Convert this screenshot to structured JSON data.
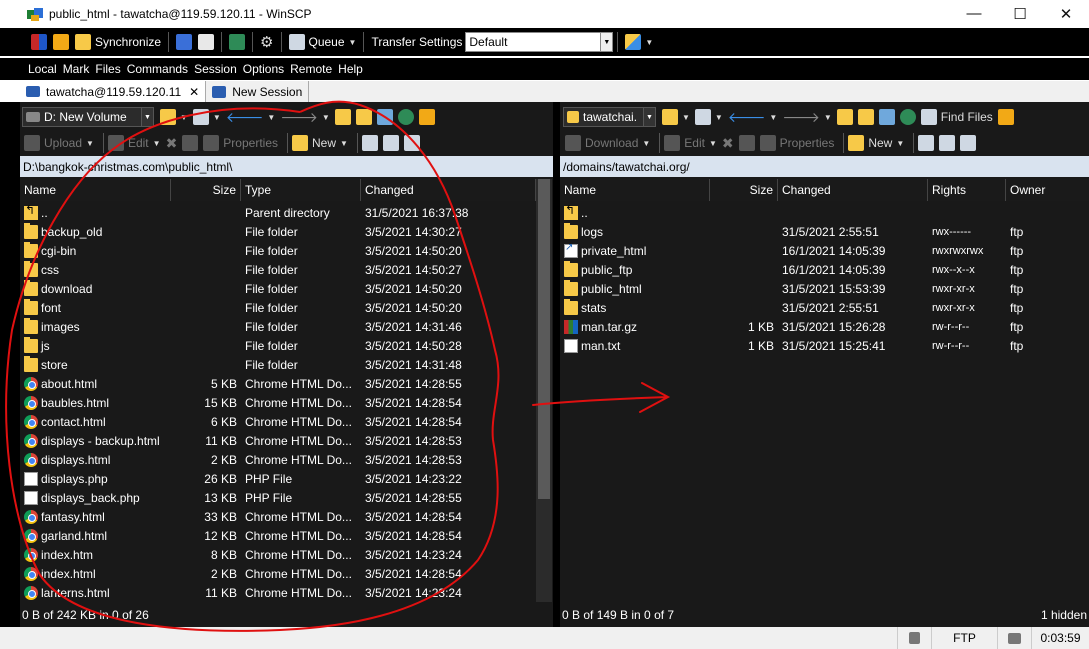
{
  "window": {
    "title": "public_html - tawatcha@119.59.120.11 - WinSCP"
  },
  "toolbar": {
    "synchronize": "Synchronize",
    "queue": "Queue",
    "transfer_settings_label": "Transfer Settings",
    "transfer_settings_value": "Default"
  },
  "menu": [
    "Local",
    "Mark",
    "Files",
    "Commands",
    "Session",
    "Options",
    "Remote",
    "Help"
  ],
  "tabs": [
    {
      "label": "tawatcha@119.59.120.11"
    },
    {
      "label": "New Session"
    }
  ],
  "left": {
    "drive": "D: New Volume",
    "actions": {
      "upload": "Upload",
      "edit": "Edit",
      "properties": "Properties",
      "new": "New"
    },
    "path": "D:\\bangkok-christmas.com\\public_html\\",
    "columns": [
      "Name",
      "Size",
      "Type",
      "Changed"
    ],
    "files": [
      {
        "name": "..",
        "size": "",
        "type": "Parent directory",
        "changed": "31/5/2021  16:37:38",
        "icon": "parent"
      },
      {
        "name": "backup_old",
        "size": "",
        "type": "File folder",
        "changed": "3/5/2021  14:30:27",
        "icon": "folder"
      },
      {
        "name": "cgi-bin",
        "size": "",
        "type": "File folder",
        "changed": "3/5/2021  14:50:20",
        "icon": "folder"
      },
      {
        "name": "css",
        "size": "",
        "type": "File folder",
        "changed": "3/5/2021  14:50:27",
        "icon": "folder"
      },
      {
        "name": "download",
        "size": "",
        "type": "File folder",
        "changed": "3/5/2021  14:50:20",
        "icon": "folder"
      },
      {
        "name": "font",
        "size": "",
        "type": "File folder",
        "changed": "3/5/2021  14:50:20",
        "icon": "folder"
      },
      {
        "name": "images",
        "size": "",
        "type": "File folder",
        "changed": "3/5/2021  14:31:46",
        "icon": "folder"
      },
      {
        "name": "js",
        "size": "",
        "type": "File folder",
        "changed": "3/5/2021  14:50:28",
        "icon": "folder"
      },
      {
        "name": "store",
        "size": "",
        "type": "File folder",
        "changed": "3/5/2021  14:31:48",
        "icon": "folder"
      },
      {
        "name": "about.html",
        "size": "5 KB",
        "type": "Chrome HTML Do...",
        "changed": "3/5/2021  14:28:55",
        "icon": "chrome"
      },
      {
        "name": "baubles.html",
        "size": "15 KB",
        "type": "Chrome HTML Do...",
        "changed": "3/5/2021  14:28:54",
        "icon": "chrome"
      },
      {
        "name": "contact.html",
        "size": "6 KB",
        "type": "Chrome HTML Do...",
        "changed": "3/5/2021  14:28:54",
        "icon": "chrome"
      },
      {
        "name": "displays - backup.html",
        "size": "11 KB",
        "type": "Chrome HTML Do...",
        "changed": "3/5/2021  14:28:53",
        "icon": "chrome"
      },
      {
        "name": "displays.html",
        "size": "2 KB",
        "type": "Chrome HTML Do...",
        "changed": "3/5/2021  14:28:53",
        "icon": "chrome"
      },
      {
        "name": "displays.php",
        "size": "26 KB",
        "type": "PHP File",
        "changed": "3/5/2021  14:23:22",
        "icon": "doc"
      },
      {
        "name": "displays_back.php",
        "size": "13 KB",
        "type": "PHP File",
        "changed": "3/5/2021  14:28:55",
        "icon": "doc"
      },
      {
        "name": "fantasy.html",
        "size": "33 KB",
        "type": "Chrome HTML Do...",
        "changed": "3/5/2021  14:28:54",
        "icon": "chrome"
      },
      {
        "name": "garland.html",
        "size": "12 KB",
        "type": "Chrome HTML Do...",
        "changed": "3/5/2021  14:28:54",
        "icon": "chrome"
      },
      {
        "name": "index.htm",
        "size": "8 KB",
        "type": "Chrome HTML Do...",
        "changed": "3/5/2021  14:23:24",
        "icon": "chrome"
      },
      {
        "name": "index.html",
        "size": "2 KB",
        "type": "Chrome HTML Do...",
        "changed": "3/5/2021  14:28:54",
        "icon": "chrome"
      },
      {
        "name": "lanterns.html",
        "size": "11 KB",
        "type": "Chrome HTML Do...",
        "changed": "3/5/2021  14:23:24",
        "icon": "chrome"
      }
    ],
    "status": "0 B of 242 KB in 0 of 26"
  },
  "right": {
    "session": "tawatchai.",
    "find_files": "Find Files",
    "actions": {
      "download": "Download",
      "edit": "Edit",
      "properties": "Properties",
      "new": "New"
    },
    "path": "/domains/tawatchai.org/",
    "columns": [
      "Name",
      "Size",
      "Changed",
      "Rights",
      "Owner"
    ],
    "files": [
      {
        "name": "..",
        "size": "",
        "changed": "",
        "rights": "",
        "owner": "",
        "icon": "parent"
      },
      {
        "name": "logs",
        "size": "",
        "changed": "31/5/2021 2:55:51",
        "rights": "rwx------",
        "owner": "ftp",
        "icon": "folder"
      },
      {
        "name": "private_html",
        "size": "",
        "changed": "16/1/2021 14:05:39",
        "rights": "rwxrwxrwx",
        "owner": "ftp",
        "icon": "link"
      },
      {
        "name": "public_ftp",
        "size": "",
        "changed": "16/1/2021 14:05:39",
        "rights": "rwx--x--x",
        "owner": "ftp",
        "icon": "folder"
      },
      {
        "name": "public_html",
        "size": "",
        "changed": "31/5/2021 15:53:39",
        "rights": "rwxr-xr-x",
        "owner": "ftp",
        "icon": "folder"
      },
      {
        "name": "stats",
        "size": "",
        "changed": "31/5/2021 2:55:51",
        "rights": "rwxr-xr-x",
        "owner": "ftp",
        "icon": "folder"
      },
      {
        "name": "man.tar.gz",
        "size": "1 KB",
        "changed": "31/5/2021 15:26:28",
        "rights": "rw-r--r--",
        "owner": "ftp",
        "icon": "archive"
      },
      {
        "name": "man.txt",
        "size": "1 KB",
        "changed": "31/5/2021 15:25:41",
        "rights": "rw-r--r--",
        "owner": "ftp",
        "icon": "doc"
      }
    ],
    "status": "0 B of 149 B in 0 of 7",
    "hidden": "1 hidden"
  },
  "statusbar": {
    "protocol": "FTP",
    "time": "0:03:59"
  },
  "colors": {
    "panel_bg": "#191919",
    "path_bg": "#d9e3ef",
    "annotation": "#e01010"
  }
}
